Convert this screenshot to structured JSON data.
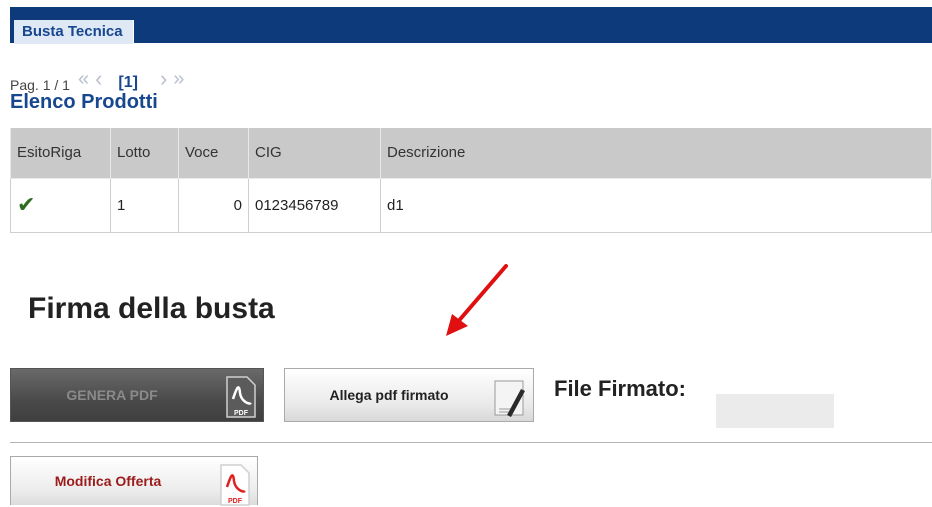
{
  "tab": {
    "label": "Busta Tecnica"
  },
  "pager": {
    "label": "Pag. 1 / 1",
    "first": "«",
    "prev": "‹",
    "current": "[1]",
    "next": "›",
    "last": "»"
  },
  "list": {
    "title": "Elenco Prodotti",
    "columns": [
      "EsitoRiga",
      "Lotto",
      "Voce",
      "CIG",
      "Descrizione"
    ],
    "rows": [
      {
        "esito": "✔",
        "lotto": "1",
        "voce": "0",
        "cig": "0123456789",
        "descrizione": "d1"
      }
    ]
  },
  "firma": {
    "title": "Firma della busta",
    "genera_label": "GENERA PDF",
    "allega_label": "Allega pdf firmato",
    "file_label": "File Firmato:",
    "modifica_label": "Modifica Offerta",
    "pdf_text": "PDF"
  },
  "colors": {
    "header": "#0d3a7a",
    "accent": "#17478f",
    "arrow": "#e01010",
    "modifica_text": "#9b1b1b"
  }
}
